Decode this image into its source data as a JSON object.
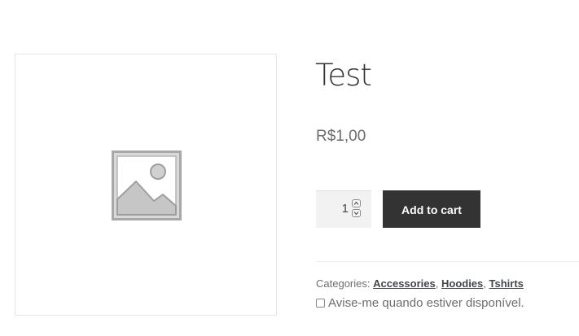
{
  "product": {
    "title": "Test",
    "price": "R$1,00",
    "image_icon": "image-placeholder-icon"
  },
  "cart_form": {
    "quantity": "1",
    "add_to_cart_label": "Add to cart"
  },
  "meta": {
    "categories_label": "Categories:",
    "categories": [
      "Accessories",
      "Hoodies",
      "Tshirts"
    ],
    "separator": ","
  },
  "notify": {
    "label": "Avise-me quando estiver disponível."
  },
  "colors": {
    "button_bg": "#333333",
    "button_text": "#ffffff",
    "text": "#43454b",
    "muted": "#6d6d6d"
  }
}
